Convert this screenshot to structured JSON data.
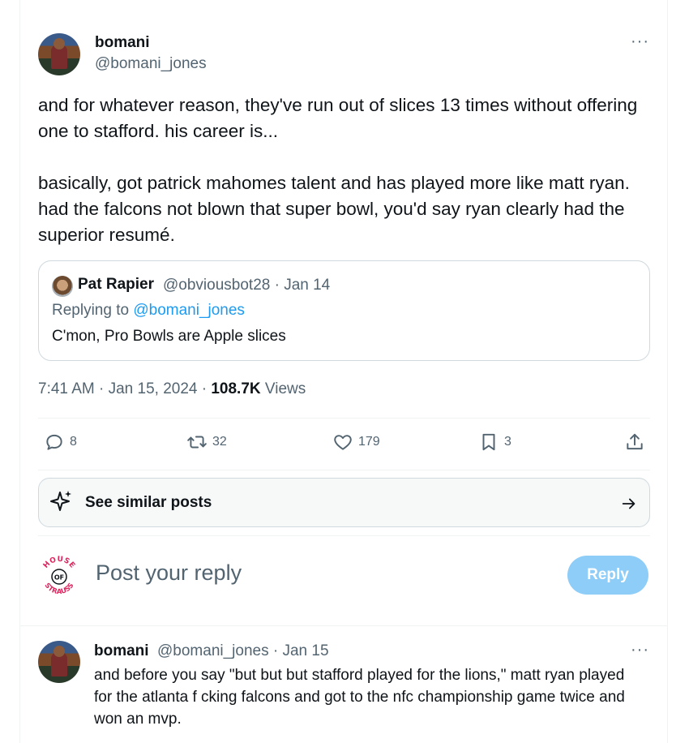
{
  "main_post": {
    "author_name": "bomani",
    "author_handle": "@bomani_jones",
    "more_label": "···",
    "text": "and for whatever reason, they've run out of slices 13 times without offering one to stafford. his career is...\n\nbasically, got patrick mahomes talent and has played more like matt ryan. had the falcons not blown that super bowl, you'd say ryan clearly had the superior resumé.",
    "quoted": {
      "author_name": "Pat Rapier",
      "meta": "@obviousbot28 · Jan 14",
      "replying_prefix": "Replying to ",
      "replying_handle": "@bomani_jones",
      "text": "C'mon, Pro Bowls are Apple slices"
    },
    "time": "7:41 AM · Jan 15, 2024 · ",
    "views_count": "108.7K",
    "views_label": " Views",
    "actions": {
      "replies": "8",
      "reposts": "32",
      "likes": "179",
      "bookmarks": "3"
    }
  },
  "similar_posts_label": "See similar posts",
  "reply_box": {
    "placeholder": "Post your reply",
    "button_label": "Reply",
    "avatar_text_top": "HOUSE",
    "avatar_text_mid": "OF",
    "avatar_text_bottom": "STRAUSS"
  },
  "reply_post": {
    "author_name": "bomani",
    "meta": "@bomani_jones · Jan 15",
    "more_label": "···",
    "text": "and before you say \"but but but stafford played for the lions,\" matt ryan played for the atlanta f cking falcons and got to the nfc championship game twice and won an mvp."
  },
  "colors": {
    "text": "#0f1419",
    "secondary": "#536471",
    "link": "#1d9bf0",
    "reply_button": "#8ecdf8",
    "border": "#cfd9de",
    "brand_red": "#e0245e"
  }
}
